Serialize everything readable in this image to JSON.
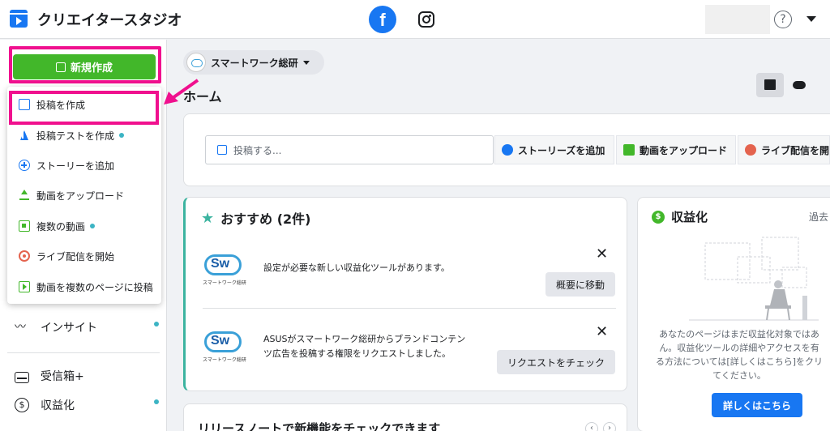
{
  "header": {
    "app_title": "クリエイタースタジオ",
    "facebook_glyph": "f",
    "help_glyph": "?"
  },
  "sidebar": {
    "create_button": "新規作成",
    "dropdown": [
      {
        "label": "投稿を作成",
        "icon": "edit-icon",
        "dot": false
      },
      {
        "label": "投稿テストを作成",
        "icon": "flask-icon",
        "dot": true
      },
      {
        "label": "ストーリーを追加",
        "icon": "plus-circle-icon",
        "dot": false
      },
      {
        "label": "動画をアップロード",
        "icon": "upload-icon",
        "dot": false
      },
      {
        "label": "複数の動画",
        "icon": "multi-video-icon",
        "dot": true
      },
      {
        "label": "ライブ配信を開始",
        "icon": "live-icon",
        "dot": false
      },
      {
        "label": "動画を複数のページに投稿",
        "icon": "share-video-icon",
        "dot": false
      }
    ],
    "nav": [
      {
        "label": "インサイト",
        "icon": "insight-icon"
      },
      {
        "label": "受信箱+",
        "icon": "inbox-icon"
      },
      {
        "label": "収益化",
        "icon": "monetization-icon"
      }
    ]
  },
  "main": {
    "page_name": "スマートワーク総研",
    "home_title": "ホーム",
    "composer": {
      "placeholder": "投稿する...",
      "actions": [
        "ストーリーズを追加",
        "動画をアップロード",
        "ライブ配信を開"
      ]
    },
    "recommendations": {
      "title": "おすすめ (2件)",
      "items": [
        {
          "text": "設定が必要な新しい収益化ツールがあります。",
          "button": "概要に移動",
          "logo_caption": "スマートワーク総研"
        },
        {
          "text_line1": "ASUSがスマートワーク総研からブランドコンテン",
          "text_line2": "ツ広告を投稿する権限をリクエストしました。",
          "button": "リクエストをチェック",
          "logo_caption": "スマートワーク総研"
        }
      ],
      "close_glyph": "✕"
    },
    "monetization": {
      "title": "収益化",
      "currency_glyph": "$",
      "period": "過去",
      "description": "あなたのページはまだ収益化対象ではあ\nん。収益化ツールの詳細やアクセスを有\nる方法については[詳しくはこちら]をクリ\nてください。",
      "button": "詳しくはこちら"
    },
    "release_notes": {
      "title": "リリースノートで新機能をチェックできます"
    }
  },
  "colors": {
    "brand_blue": "#1877f2",
    "create_green": "#42b72a",
    "highlight_pink": "#f0108e",
    "accent_teal": "#3cb4a0"
  }
}
